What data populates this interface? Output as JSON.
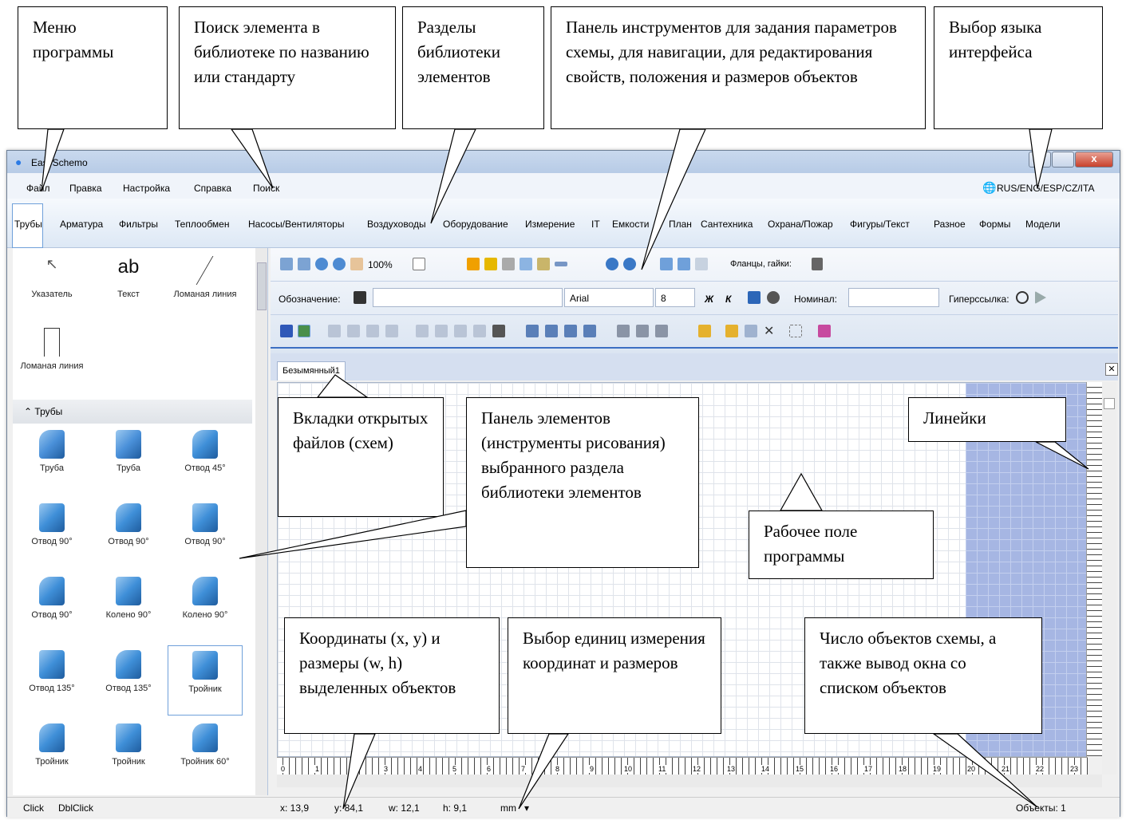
{
  "window": {
    "title": "EasySchemo"
  },
  "menu": [
    "Файл",
    "Правка",
    "Настройка",
    "Справка",
    "Поиск"
  ],
  "language": "RUS/ENG/ESP/CZ/ITA",
  "sections": [
    "Трубы",
    "Арматура",
    "Фильтры",
    "Теплообмен",
    "Насосы/Вентиляторы",
    "Воздуховоды",
    "Оборудование",
    "Измерение",
    "IT",
    "Емкости",
    "План",
    "Сантехника",
    "Охрана/Пожар",
    "Фигуры/Текст",
    "Разное",
    "Формы",
    "Модели"
  ],
  "tools": [
    "Указатель",
    "Текст",
    "Ломаная линия",
    "Ломаная линия"
  ],
  "group": "Трубы",
  "elements": [
    "Труба",
    "Труба",
    "Отвод 45°",
    "Отвод 90°",
    "Отвод 90°",
    "Отвод 90°",
    "Отвод 90°",
    "Колено 90°",
    "Колено 90°",
    "Отвод 135°",
    "Отвод 135°",
    "Тройник",
    "Тройник",
    "Тройник",
    "Тройник 60°"
  ],
  "toolbar": {
    "zoom": "100%",
    "flanges": "Фланцы, гайки:",
    "designation": "Обозначение:",
    "font": "Arial",
    "size": "8",
    "bold": "Ж",
    "italic": "К",
    "nominal": "Номинал:",
    "hyperlink": "Гиперссылка:"
  },
  "tab": "Безымянный1",
  "ruler_h": [
    "0",
    "1",
    "2",
    "3",
    "4",
    "5",
    "6",
    "7",
    "8",
    "9",
    "10",
    "11",
    "12",
    "13",
    "14",
    "15",
    "16",
    "17",
    "18",
    "19",
    "20",
    "21",
    "22",
    "23"
  ],
  "status": {
    "click": "Click",
    "dblclick": "DblClick",
    "x": "x: 13,9",
    "y": "y: 84,1",
    "w": "w: 12,1",
    "h": "h: 9,1",
    "units": "mm",
    "objects": "Объекты: 1"
  },
  "callouts": {
    "menu": "Меню программы",
    "search": "Поиск элемента в библиотеке по названию или стандарту",
    "sections": "Разделы библиотеки элементов",
    "toolbar": "Панель инструментов для задания параметров схемы, для навигации, для редактирования свойств, положения и размеров объектов",
    "lang": "Выбор языка интерфейса",
    "tabs": "Вкладки открытых файлов (схем)",
    "panel": "Панель элементов (инструменты рисования) выбранного раздела библиотеки элементов",
    "rulers": "Линейки",
    "workspace": "Рабочее поле программы",
    "coords": "Координаты (x, y) и размеры (w, h) выделенных объектов",
    "units": "Выбор единиц измерения координат и размеров",
    "count": "Число объектов схемы, а также вывод окна со списком объектов"
  }
}
